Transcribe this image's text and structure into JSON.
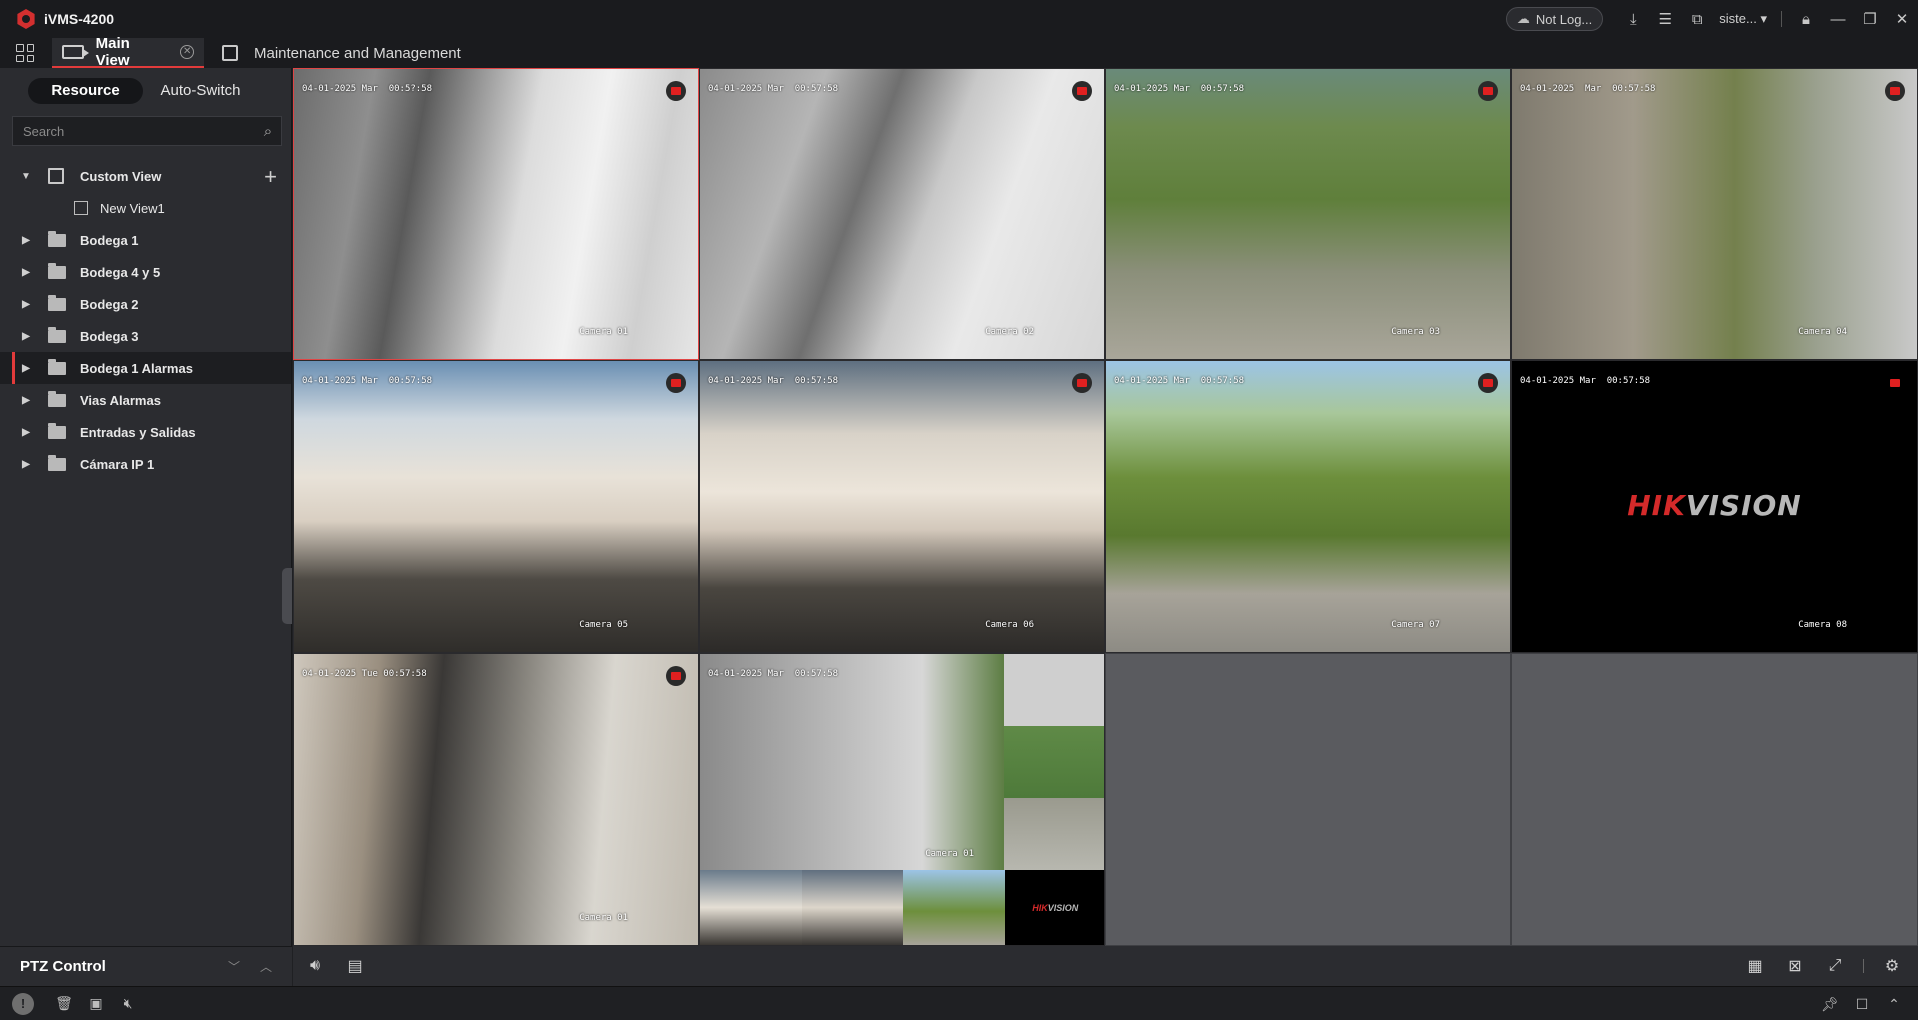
{
  "app": {
    "title": "iVMS-4200"
  },
  "titlebar": {
    "cloud_status": "Not Log...",
    "user": "siste...",
    "icons": [
      "cloud-icon",
      "download-icon",
      "task-list-icon",
      "monitor-chart-icon",
      "lock-icon",
      "minimize-icon",
      "restore-icon",
      "close-icon"
    ]
  },
  "tabs": [
    {
      "label": "Main View",
      "active": true
    },
    {
      "label": "Maintenance and Management",
      "active": false
    }
  ],
  "left_panel": {
    "segments": [
      "Resource",
      "Auto-Switch"
    ],
    "active_segment": "Resource",
    "search_placeholder": "Search",
    "tree": [
      {
        "label": "Custom View",
        "expanded": true,
        "children": [
          {
            "label": "New View1"
          }
        ]
      },
      {
        "label": "Bodega 1"
      },
      {
        "label": "Bodega 4 y 5"
      },
      {
        "label": "Bodega 2"
      },
      {
        "label": "Bodega 3"
      },
      {
        "label": "Bodega 1 Alarmas",
        "selected": true
      },
      {
        "label": "Vias Alarmas"
      },
      {
        "label": "Entradas y Salidas"
      },
      {
        "label": "Cámara IP 1"
      }
    ],
    "ptz": {
      "label": "PTZ Control"
    }
  },
  "video": {
    "cells": [
      {
        "time": "04-01-2025 Mar  00:5?:58",
        "camera": "Camera 01"
      },
      {
        "time": "04-01-2025 Mar  00:57:58",
        "camera": "Camera 02"
      },
      {
        "time": "04-01-2025 Mar  00:57:58",
        "camera": "Camera 03"
      },
      {
        "time": "04-01-2025  Mar  00:57:58",
        "camera": "Camera 04"
      },
      {
        "time": "04-01-2025 Mar  00:57:58",
        "camera": "Camera 05"
      },
      {
        "time": "04-01-2025 Mar  00:57:58",
        "camera": "Camera 06"
      },
      {
        "time": "04-01-2025 Mar  00:57:58",
        "camera": "Camera 07"
      },
      {
        "time": "04-01-2025 Mar  00:57:58",
        "camera": "Camera 08"
      },
      {
        "time": "04-01-2025 Tue 00:57:58",
        "camera": "Camera 01"
      },
      {
        "time": "04-01-2025 Mar  00:57:58",
        "camera": "Camera 01"
      }
    ],
    "brand_hik": "HIK",
    "brand_vision": "VISION"
  },
  "colors": {
    "accent": "#e23b3b",
    "recording": "#e02020",
    "panel": "#2b2c30",
    "background": "#1f2023"
  }
}
